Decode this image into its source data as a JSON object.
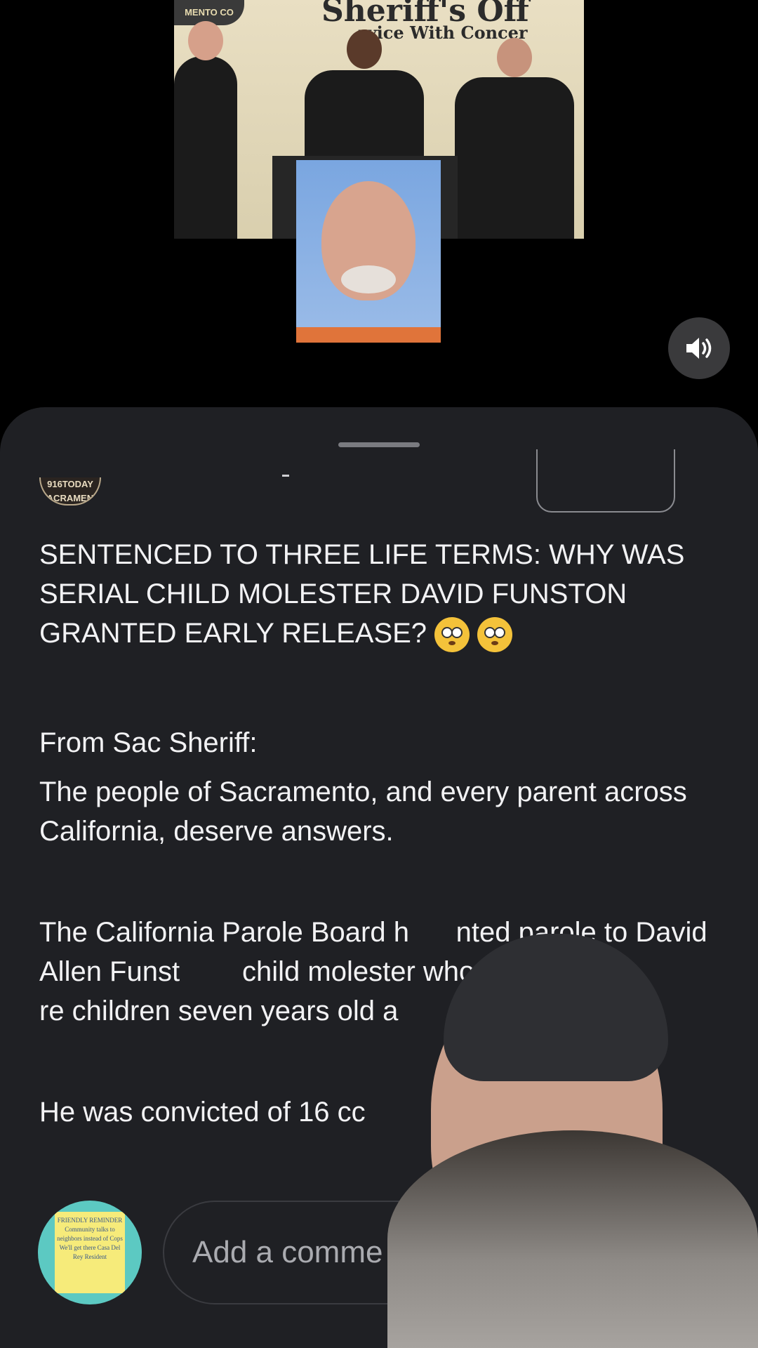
{
  "video": {
    "sign_title": "Sheriff's Off",
    "sign_subtitle": "rvice With Concer",
    "seal_text": "MENTO CO"
  },
  "sound_button": {
    "icon": "speaker-icon",
    "state": "on"
  },
  "post": {
    "source_logo": "916TODAY SACRAMENTO",
    "headline": "SENTENCED TO THREE LIFE TERMS: WHY WAS SERIAL CHILD MOLESTER DAVID FUNSTON GRANTED EARLY RELEASE?",
    "headline_emoji": "flushed-face-emoji",
    "from_line": "From Sac Sheriff:",
    "paragraph1": "The people of Sacramento, and every parent across California, deserve answers.",
    "paragraph2": "The California Parole Board h      nted parole to David Allen Funst        child molester who used candy              re children seven years old a",
    "paragraph3": "He was convicted of 16 cc"
  },
  "comment_bar": {
    "placeholder": "Add a comme",
    "avatar_note": "FRIENDLY REMINDER Community talks to neighbors instead of Cops We'll get there Casa Del Rey Resident"
  },
  "colors": {
    "sheet_bg": "#1f2024",
    "text": "#f2f2f4",
    "placeholder": "#aaabb0"
  }
}
